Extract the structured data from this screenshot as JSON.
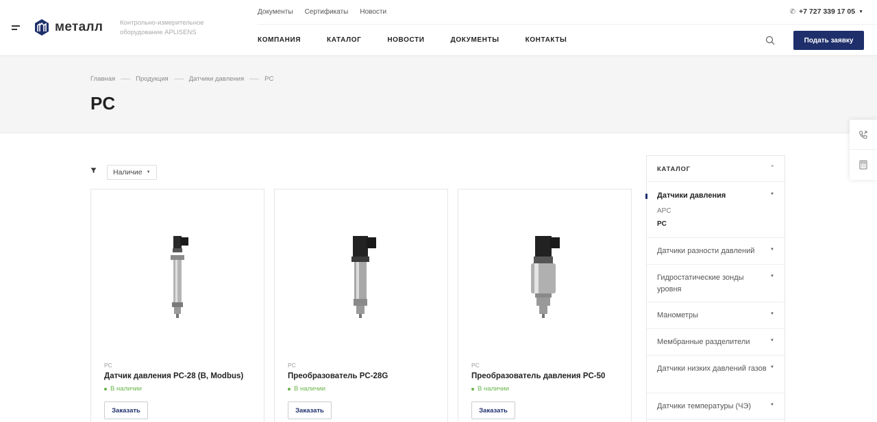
{
  "header": {
    "logo_text": "металл",
    "tagline": "Контрольно-измерительное оборудование APLISENS",
    "top_links": [
      "Документы",
      "Сертификаты",
      "Новости"
    ],
    "phone": "+7 727 339 17 05",
    "nav": [
      "КОМПАНИЯ",
      "КАТАЛОГ",
      "НОВОСТИ",
      "ДОКУМЕНТЫ",
      "КОНТАКТЫ"
    ],
    "cta_label": "Подать заявку",
    "brand_color": "#1e2f6b"
  },
  "breadcrumb": [
    "Главная",
    "Продукция",
    "Датчики давления",
    "PC"
  ],
  "page_title": "PC",
  "filter": {
    "selected": "Наличие"
  },
  "products": [
    {
      "category": "PC",
      "name": "Датчик давления PC-28 (B, Modbus)",
      "stock": "В наличии",
      "order_label": "Заказать",
      "image_icon": "pressure-sensor-slim"
    },
    {
      "category": "PC",
      "name": "Преобразователь PC-28G",
      "stock": "В наличии",
      "order_label": "Заказать",
      "image_icon": "pressure-transmitter"
    },
    {
      "category": "PC",
      "name": "Преобразователь давления PC-50",
      "stock": "В наличии",
      "order_label": "Заказать",
      "image_icon": "pressure-transmitter-wide"
    }
  ],
  "sidebar": {
    "title": "КАТАЛОГ",
    "active_group": "Датчики давления",
    "active_children": [
      "APC",
      "PC"
    ],
    "items": [
      "Датчики разности давлений",
      "Гидростатические зонды уровня",
      "Манометры",
      "Мембранные разделители",
      "Датчики низких давлений газов",
      "Датчики температуры (ЧЭ)"
    ]
  },
  "colors": {
    "stock_green": "#6ab54a",
    "band_bg": "#f5f5f5"
  }
}
